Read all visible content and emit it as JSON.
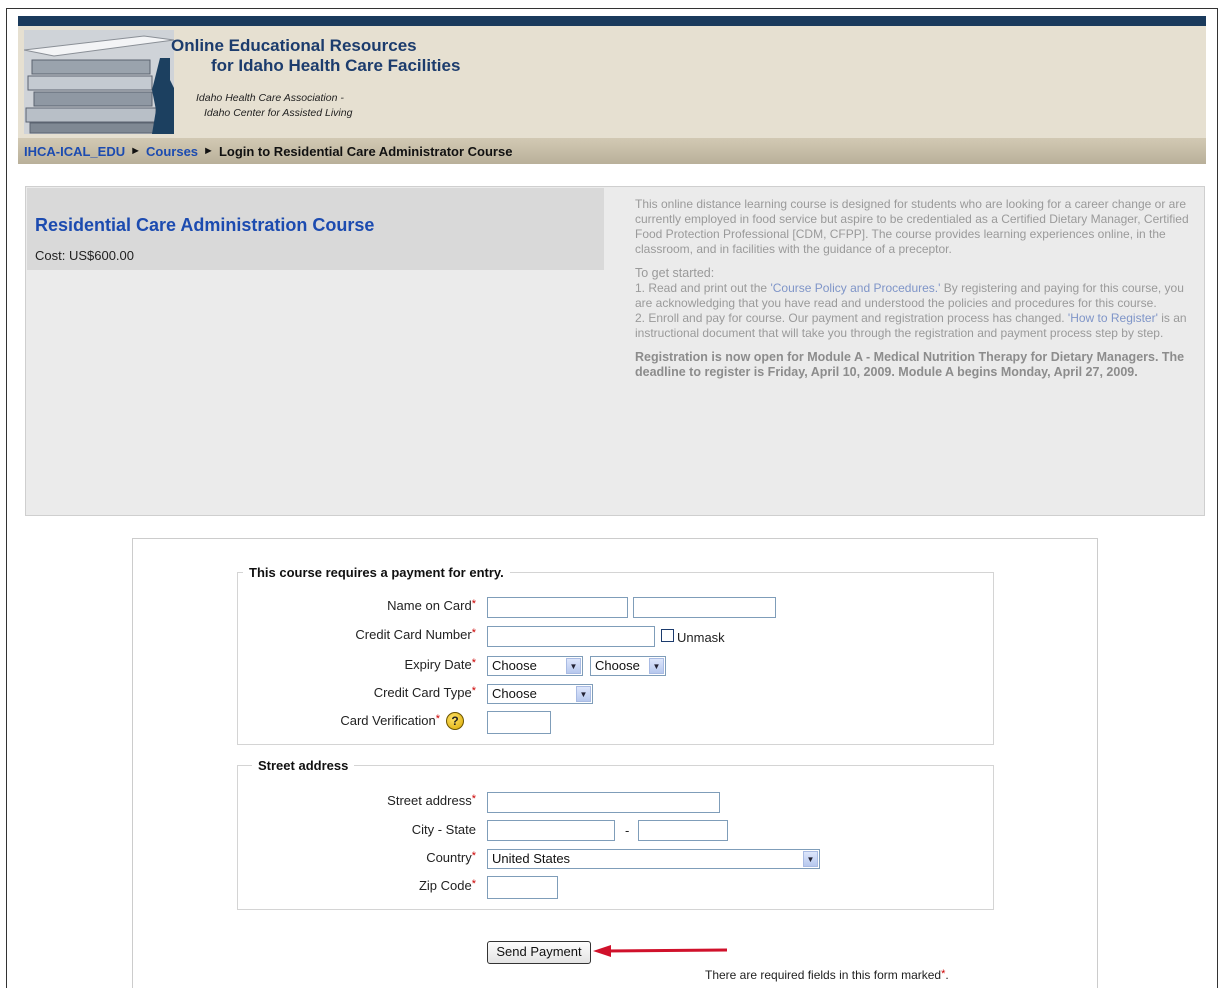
{
  "header": {
    "title_line1": "Online Educational Resources",
    "title_line2": "for Idaho Health Care Facilities",
    "subtitle_line1": "Idaho Health Care Association -",
    "subtitle_line2": "Idaho Center for Assisted Living"
  },
  "breadcrumb": {
    "items": [
      "IHCA-ICAL_EDU",
      "Courses"
    ],
    "separator": "►",
    "current": "Login to Residential Care Administrator Course"
  },
  "course": {
    "name": "Residential Care Administration Course",
    "cost": "Cost: US$600.00",
    "description": "This online distance learning course is designed for students who are looking for a career change or are currently employed in food service but aspire to be credentialed as a Certified Dietary Manager, Certified Food Protection Professional [CDM, CFPP]. The course provides learning experiences online, in the classroom, and in facilities with the guidance of a preceptor.",
    "get_started_title": "To get started:",
    "step1_prefix": "1. Read and print out the ",
    "step1_link": "'Course Policy and Procedures.'",
    "step1_suffix": " By registering and paying for this course, you are acknowledging that you have read and understood the policies and procedures for this course.",
    "step2_prefix": "2. Enroll and pay for course. Our payment and registration process has changed. ",
    "step2_link": "'How to Register'",
    "step2_suffix": " is an instructional document that will take you through the registration and payment process step by step.",
    "announcement": "Registration is now open for Module A - Medical Nutrition Therapy for Dietary Managers. The deadline to register is Friday, April 10, 2009. Module A begins Monday, April 27, 2009."
  },
  "payment": {
    "legend": "This course requires a payment for entry.",
    "name_label": "Name on Card",
    "card_number_label": "Credit Card Number",
    "unmask_label": "Unmask",
    "expiry_label": "Expiry Date",
    "expiry_month": "Choose",
    "expiry_year": "Choose",
    "card_type_label": "Credit Card Type",
    "card_type": "Choose",
    "verification_label": "Card Verification",
    "help_glyph": "?",
    "required_marker": "*"
  },
  "address": {
    "legend": "Street address",
    "street_label": "Street address",
    "city_state_label": "City - State",
    "city_state_sep": "-",
    "country_label": "Country",
    "country_value": "United States",
    "zip_label": "Zip Code"
  },
  "actions": {
    "send_label": "Send Payment",
    "required_note": "There are required fields in this form marked"
  },
  "colors": {
    "link": "#1c4bb0",
    "required": "#cc0000",
    "annotation_arrow": "#d0112b"
  }
}
